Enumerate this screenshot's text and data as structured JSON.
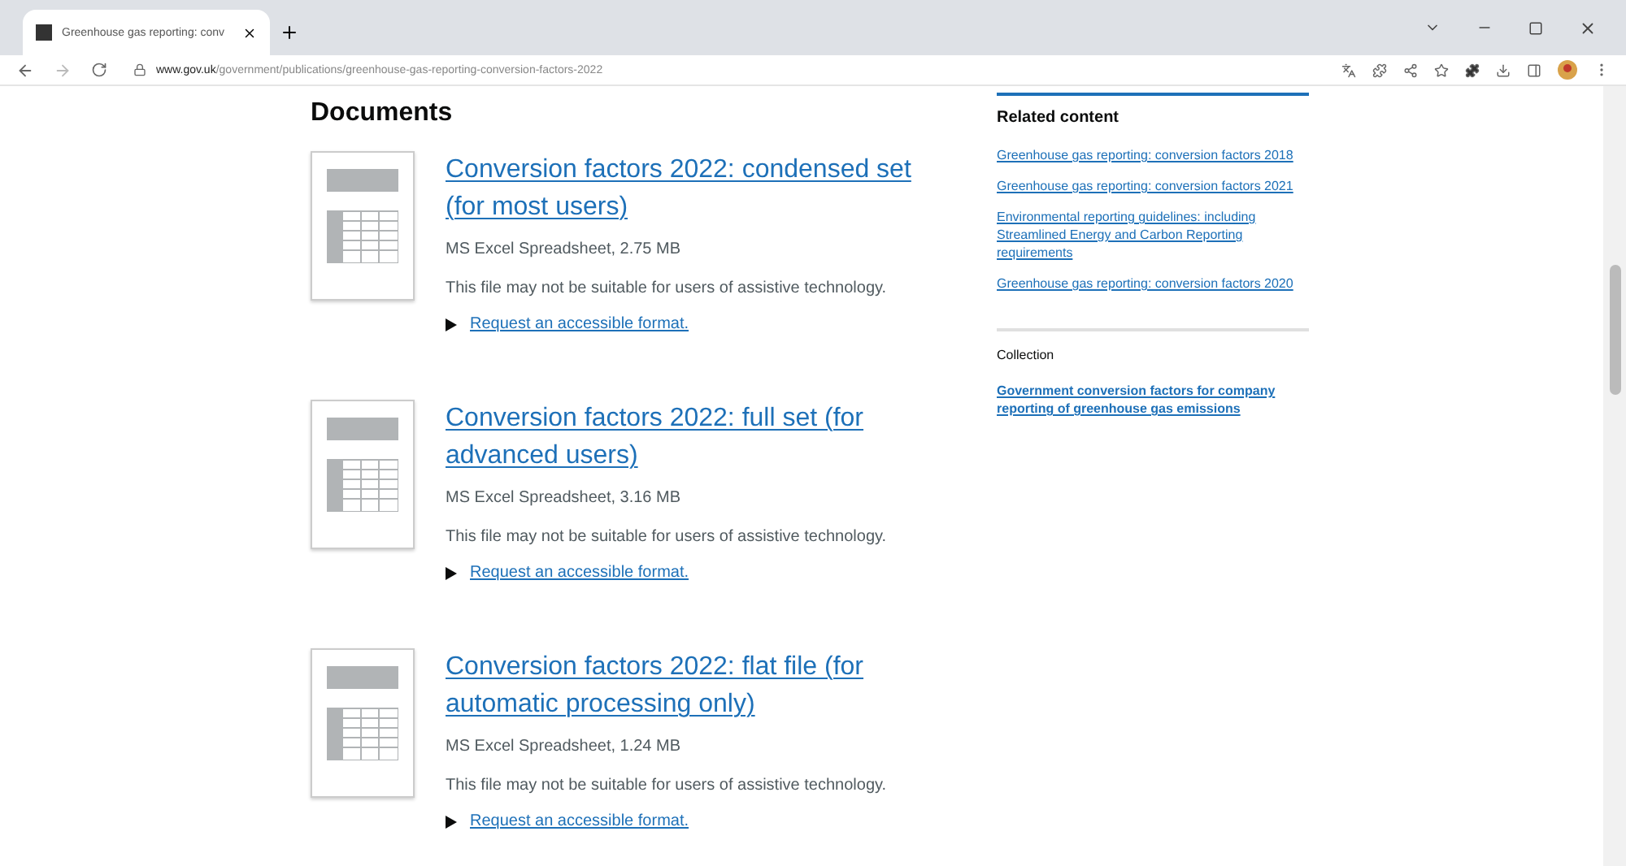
{
  "browser": {
    "tab": {
      "title": "Greenhouse gas reporting: conv",
      "selected": true
    },
    "url": {
      "domain": "www.gov.uk",
      "path": "/government/publications/greenhouse-gas-reporting-conversion-factors-2022"
    }
  },
  "documents": {
    "heading": "Documents",
    "items": [
      {
        "title": "Conversion factors 2022: condensed set (for most users)",
        "meta": "MS Excel Spreadsheet, 2.75 MB",
        "notice": "This file may not be suitable for users of assistive technology.",
        "request": "Request an accessible format.",
        "expanded": false
      },
      {
        "title": "Conversion factors 2022: full set (for advanced users)",
        "meta": "MS Excel Spreadsheet, 3.16 MB",
        "notice": "This file may not be suitable for users of assistive technology.",
        "request": "Request an accessible format.",
        "expanded": false
      },
      {
        "title": "Conversion factors 2022: flat file (for automatic processing only)",
        "meta": "MS Excel Spreadsheet, 1.24 MB",
        "notice": "This file may not be suitable for users of assistive technology.",
        "request": "Request an accessible format.",
        "expanded": false
      }
    ]
  },
  "sidebar": {
    "related_heading": "Related content",
    "related_links": [
      "Greenhouse gas reporting: conversion factors 2018",
      "Greenhouse gas reporting: conversion factors 2021",
      "Environmental reporting guidelines: including Streamlined Energy and Carbon Reporting requirements",
      "Greenhouse gas reporting: conversion factors 2020"
    ],
    "collection_heading": "Collection",
    "collection_link": "Government conversion factors for company reporting of greenhouse gas emissions"
  }
}
